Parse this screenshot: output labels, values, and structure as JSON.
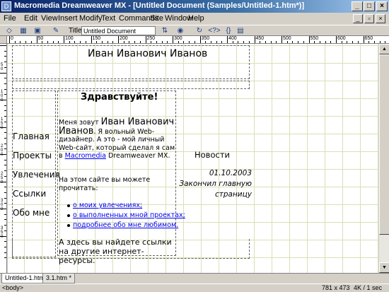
{
  "window": {
    "title": "Macromedia Dreamweaver MX - [Untitled Document (Samples/Untitled-1.htm*)]",
    "app_icon": "dreamweaver-icon",
    "controls": [
      "_",
      "□",
      "×"
    ]
  },
  "menu": [
    "File",
    "Edit",
    "View",
    "Insert",
    "Modify",
    "Text",
    "Commands",
    "Site",
    "Window",
    "Help"
  ],
  "toolbar": {
    "title_label": "Title:",
    "title_value": "Untitled Document"
  },
  "ruler": {
    "h_labels": [
      "0",
      "50",
      "100",
      "150",
      "200",
      "250",
      "300",
      "350",
      "400",
      "450",
      "500",
      "550",
      "600",
      "650",
      "700"
    ],
    "v_labels": [
      "50",
      "100",
      "150",
      "200",
      "250",
      "300",
      "350"
    ]
  },
  "page": {
    "name": "Иван Иванович Иванов",
    "greeting": "Здравствуйте!",
    "nav": [
      "Главная",
      "Проекты",
      "Увлечения",
      "Ссылки",
      "Обо мне"
    ],
    "intro_prefix": "Меня зовут ",
    "intro_name": "Иван Иванович Иванов",
    "intro_mid": ". Я вольный Web-дизайнер. А это - мой личный Web-сайт, который сделал я сам в ",
    "intro_link": "Macromedia",
    "intro_suffix": " Dreamweaver MX.",
    "read_more": "На этом сайте вы можете прочитать:",
    "list": [
      "о моих увлечениях;",
      "о выполненных мной проектах;",
      "подробнее обо мне любимом."
    ],
    "links_text": "А здесь вы найдете ссылки на другие интернет-ресурсы.",
    "news_title": "Новости",
    "news_date": "01.10.2003",
    "news_text": "Закончил главную страницу"
  },
  "tabs": [
    "Untitled-1.htm *",
    "3.1.htm *"
  ],
  "status": {
    "tag": "<body>",
    "size": "781 x 473",
    "download": "4K / 1 sec"
  }
}
